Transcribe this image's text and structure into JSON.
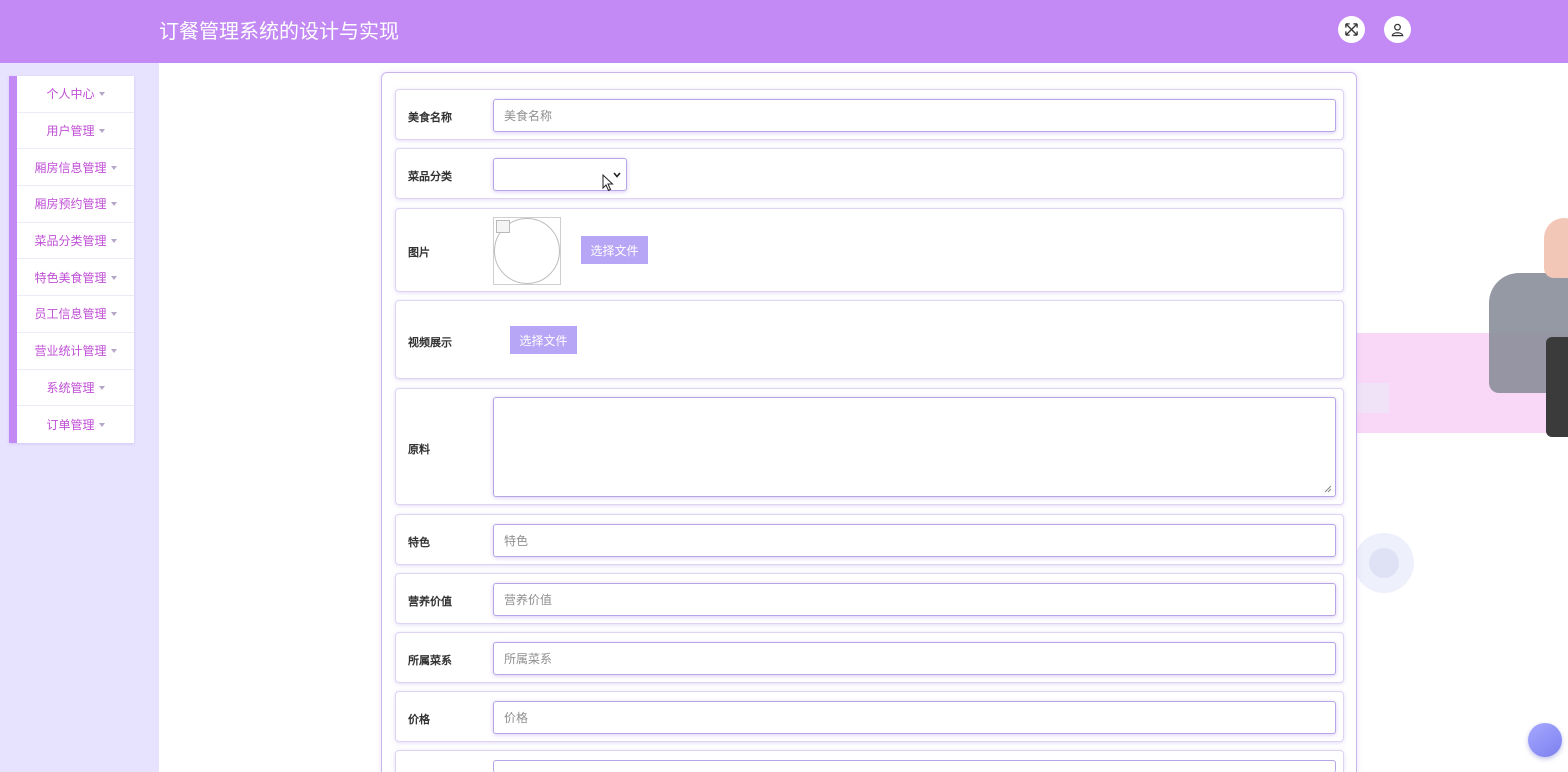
{
  "header": {
    "title": "订餐管理系统的设计与实现",
    "fullscreen_icon": "expand-arrows-icon",
    "user_icon": "user-icon"
  },
  "sidebar": {
    "items": [
      {
        "label": "个人中心"
      },
      {
        "label": "用户管理"
      },
      {
        "label": "厢房信息管理"
      },
      {
        "label": "厢房预约管理"
      },
      {
        "label": "菜品分类管理"
      },
      {
        "label": "特色美食管理"
      },
      {
        "label": "员工信息管理"
      },
      {
        "label": "营业统计管理"
      },
      {
        "label": "系统管理"
      },
      {
        "label": "订单管理"
      }
    ]
  },
  "form": {
    "name": {
      "label": "美食名称",
      "placeholder": "美食名称"
    },
    "category": {
      "label": "菜品分类",
      "value": ""
    },
    "image": {
      "label": "图片",
      "button": "选择文件"
    },
    "video": {
      "label": "视频展示",
      "button": "选择文件"
    },
    "ingredients": {
      "label": "原料"
    },
    "feature": {
      "label": "特色",
      "placeholder": "特色"
    },
    "nutrition": {
      "label": "营养价值",
      "placeholder": "营养价值"
    },
    "cuisine": {
      "label": "所属菜系",
      "placeholder": "所属菜系"
    },
    "price": {
      "label": "价格",
      "placeholder": "价格"
    }
  },
  "colors": {
    "accent": "#c389f4",
    "sidebar_bg": "#e7e3ff",
    "menu_text": "#c04fd6",
    "button": "#b7a6f5"
  }
}
